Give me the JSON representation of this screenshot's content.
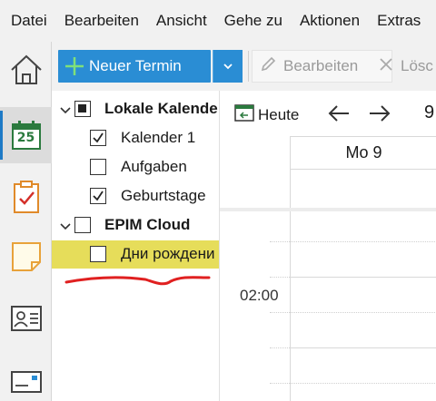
{
  "menu": [
    "Datei",
    "Bearbeiten",
    "Ansicht",
    "Gehe zu",
    "Aktionen",
    "Extras"
  ],
  "nav": [
    {
      "name": "home",
      "icon": "home-icon"
    },
    {
      "name": "calendar",
      "icon": "calendar-icon",
      "day": "25",
      "active": true
    },
    {
      "name": "tasks",
      "icon": "clipboard-check-icon"
    },
    {
      "name": "notes",
      "icon": "sticky-note-icon"
    },
    {
      "name": "contacts",
      "icon": "contact-card-icon"
    },
    {
      "name": "mail",
      "icon": "envelope-icon"
    }
  ],
  "toolbar": {
    "new_label": "Neuer Termin",
    "edit_label": "Bearbeiten",
    "delete_label": "Lösc"
  },
  "tree": {
    "local_group": "Lokale Kalende",
    "local_items": [
      {
        "label": "Kalender 1",
        "checked": true
      },
      {
        "label": "Aufgaben",
        "checked": false
      },
      {
        "label": "Geburtstage",
        "checked": true
      }
    ],
    "cloud_group": "EPIM Cloud",
    "cloud_items": [
      {
        "label": "Дни рождени",
        "checked": false,
        "highlighted": true
      }
    ]
  },
  "calendar": {
    "today_label": "Heute",
    "date_fragment": "9",
    "day_header": "Mo 9",
    "time_label": "02:00"
  },
  "colors": {
    "accent": "#2a8dd4",
    "highlight": "#e6dd5a",
    "annotation": "#e02020"
  }
}
